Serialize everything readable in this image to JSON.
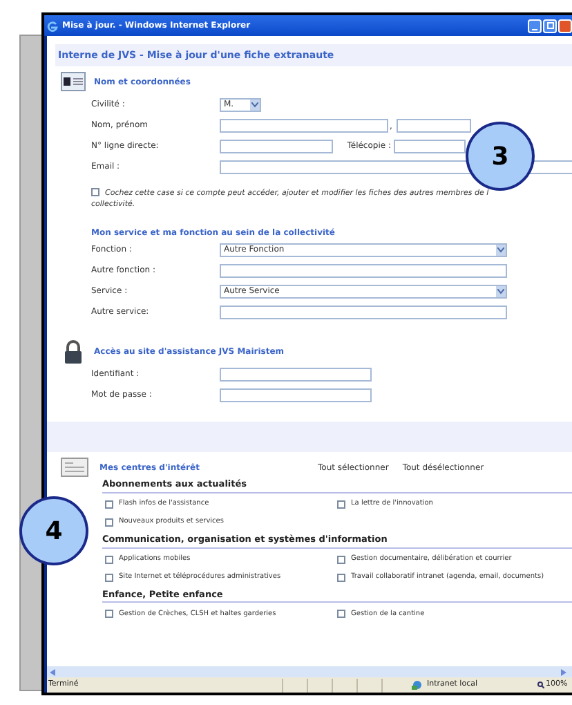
{
  "window": {
    "title": "Mise à jour. - Windows Internet Explorer"
  },
  "header": "Interne de JVS - Mise à jour d'une fiche extranaute",
  "identity": {
    "title": "Nom et coordonnées",
    "fields": [
      {
        "kind": "select_short",
        "label": "Civilité :",
        "value": "M."
      },
      {
        "kind": "name_pair",
        "label": "Nom, prénom",
        "separator": ","
      },
      {
        "kind": "phone_fax",
        "label": "N° ligne directe:",
        "fax_label": "Télécopie :"
      },
      {
        "kind": "text_long",
        "label": "Email :"
      }
    ]
  },
  "share": {
    "checked": false,
    "line_1": "Cochez cette case si ce compte peut accéder, ajouter et modifier les fiches des autres membres de l",
    "line_2": "collectivité."
  },
  "service": {
    "title": "Mon service et ma fonction au sein de la collectivité",
    "fields": [
      {
        "kind": "select_wide",
        "label": "Fonction :",
        "value": "Autre Fonction"
      },
      {
        "kind": "text_wide",
        "label": "Autre fonction :"
      },
      {
        "kind": "select_wide",
        "label": "Service :",
        "value": "Autre Service"
      },
      {
        "kind": "text_wide",
        "label": "Autre service:"
      }
    ]
  },
  "access": {
    "title": "Accès au site d'assistance JVS Mairistem",
    "fields": [
      {
        "kind": "text_medium",
        "label": "Identifiant :"
      },
      {
        "kind": "text_medium",
        "label": "Mot de passe :"
      }
    ]
  },
  "interests": {
    "title": "Mes centres d'intérêt",
    "select_all": "Tout sélectionner",
    "deselect_all": "Tout désélectionner",
    "groups": [
      {
        "title": "Abonnements aux actualités",
        "items": [
          {
            "label": "Flash infos de l'assistance",
            "checked": false
          },
          {
            "label": "La lettre de l'innovation",
            "checked": false
          },
          {
            "label": "Nouveaux produits et services",
            "checked": false
          }
        ]
      },
      {
        "title": "Communication, organisation et systèmes d'information",
        "items": [
          {
            "label": "Applications mobiles",
            "checked": false
          },
          {
            "label": "Gestion documentaire, délibération et courrier",
            "checked": false
          },
          {
            "label": "Site Internet et téléprocédures administratives",
            "checked": false
          },
          {
            "label": "Travail collaboratif intranet (agenda, email, documents)",
            "checked": false
          }
        ]
      },
      {
        "title": "Enfance, Petite enfance",
        "items": [
          {
            "label": "Gestion de Crèches, CLSH et haltes garderies",
            "checked": false
          },
          {
            "label": "Gestion de la cantine",
            "checked": false
          }
        ]
      }
    ]
  },
  "status_bar": {
    "text": "Terminé",
    "zone": "Intranet local",
    "zoom": "100%"
  },
  "callouts": [
    "3",
    "4"
  ]
}
